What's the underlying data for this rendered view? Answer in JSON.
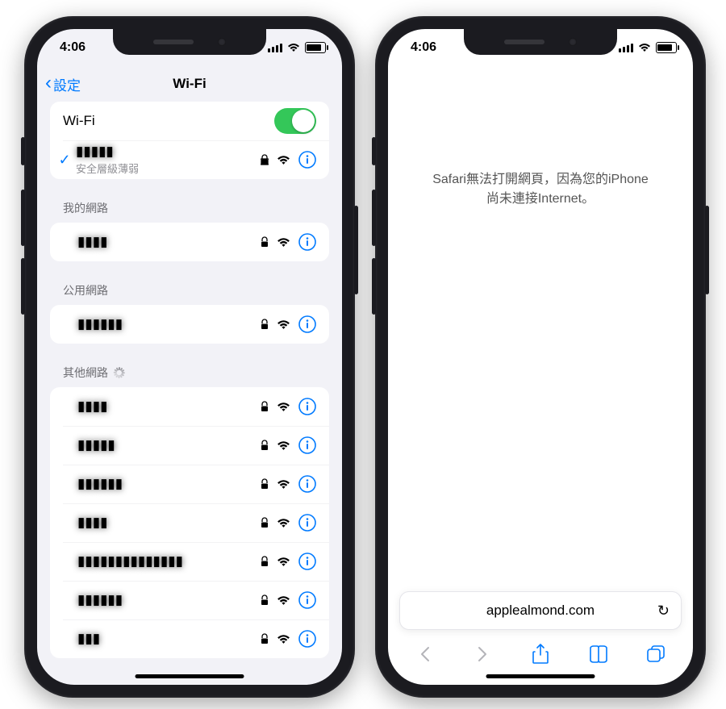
{
  "status": {
    "time": "4:06"
  },
  "settings": {
    "back_label": "設定",
    "title": "Wi-Fi",
    "wifi_row_label": "Wi-Fi",
    "wifi_on": true,
    "connected": {
      "name": "▮▮▮▮▮",
      "subtitle": "安全層級薄弱"
    },
    "sections": {
      "my_networks": {
        "heading": "我的網路",
        "items": [
          {
            "name": "▮▮▮▮"
          }
        ]
      },
      "public_networks": {
        "heading": "公用網路",
        "items": [
          {
            "name": "▮▮▮▮▮▮"
          }
        ]
      },
      "other_networks": {
        "heading": "其他網路",
        "loading": true,
        "items": [
          {
            "name": "▮▮▮▮"
          },
          {
            "name": "▮▮▮▮▮"
          },
          {
            "name": "▮▮▮▮▮▮"
          },
          {
            "name": "▮▮▮▮"
          },
          {
            "name": "▮▮▮▮▮▮▮▮▮▮▮▮▮▮"
          },
          {
            "name": "▮▮▮▮▮▮"
          },
          {
            "name": "▮▮▮"
          }
        ]
      }
    }
  },
  "safari": {
    "error_line1": "Safari無法打開網頁，因為您的iPhone",
    "error_line2": "尚未連接Internet。",
    "url": "applealmond.com"
  },
  "colors": {
    "accent": "#007aff",
    "toggle_on": "#34c759",
    "bg": "#f2f2f7"
  }
}
